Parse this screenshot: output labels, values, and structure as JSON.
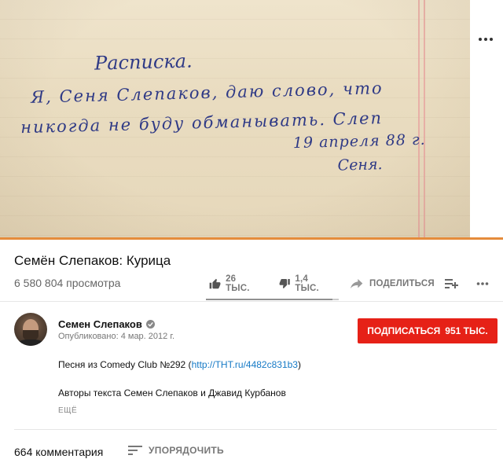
{
  "photo": {
    "handwriting": {
      "title": "Расписка.",
      "line1": "Я, Сеня Слепаков, даю слово, что",
      "line2": "никогда не буду обманывать. Слеп",
      "date": "19 апреля 88 г.",
      "signature": "Сеня."
    },
    "ink_color": "#2f3a86",
    "margin_color": "#e7a8a2"
  },
  "top_menu": {
    "icon": "more-vert-icon"
  },
  "accent_color": "#e58c3c",
  "video": {
    "title": "Семён Слепаков: Курица",
    "views": "6 580 804 просмотра",
    "like_count": "26 ТЫС.",
    "dislike_count": "1,4 ТЫС.",
    "share_label": "ПОДЕЛИТЬСЯ",
    "like_ratio": 0.95
  },
  "channel": {
    "name": "Семен Слепаков",
    "published": "Опубликовано: 4 мар. 2012 г.",
    "subscribe_label": "ПОДПИСАТЬСЯ",
    "subscriber_count": "951 ТЫС.",
    "subscribe_color": "#e62117"
  },
  "description": {
    "line1_prefix": "Песня из Comedy Club №292 (",
    "line1_link": "http://THT.ru/4482c831b3",
    "line1_suffix": ")",
    "line2": "Авторы текста Семен Слепаков и Джавид Курбанов",
    "more_label": "ЕЩЁ",
    "link_color": "#167ac6"
  },
  "comments": {
    "count_label": "664 комментария",
    "sort_label": "УПОРЯДОЧИТЬ"
  }
}
